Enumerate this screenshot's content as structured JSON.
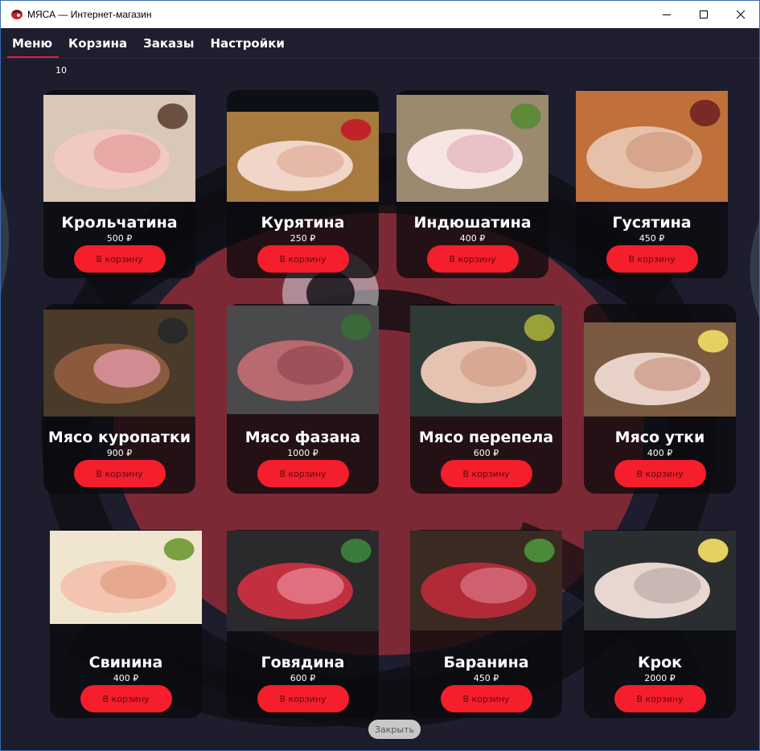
{
  "window": {
    "title": "МЯСА — Интернет-магазин",
    "minimize": "—",
    "maximize": "☐",
    "close": "✕"
  },
  "nav": {
    "tabs": [
      {
        "label": "Меню",
        "active": true
      },
      {
        "label": "Корзина",
        "active": false
      },
      {
        "label": "Заказы",
        "active": false
      },
      {
        "label": "Настройки",
        "active": false
      }
    ]
  },
  "counter": "10",
  "products": [
    {
      "name": "Крольчатина",
      "price": "500 ₽",
      "button": "В корзину",
      "image": "rabbit-meat-image"
    },
    {
      "name": "Курятина",
      "price": "250 ₽",
      "button": "В корзину",
      "image": "chicken-meat-image"
    },
    {
      "name": "Индюшатина",
      "price": "400 ₽",
      "button": "В корзину",
      "image": "turkey-meat-image"
    },
    {
      "name": "Гусятина",
      "price": "450 ₽",
      "button": "В корзину",
      "image": "goose-meat-image"
    },
    {
      "name": "Мясо куропатки",
      "price": "900 ₽",
      "button": "В корзину",
      "image": "partridge-meat-image"
    },
    {
      "name": "Мясо фазана",
      "price": "1000 ₽",
      "button": "В корзину",
      "image": "pheasant-meat-image"
    },
    {
      "name": "Мясо перепела",
      "price": "600 ₽",
      "button": "В корзину",
      "image": "quail-meat-image"
    },
    {
      "name": "Мясо утки",
      "price": "400 ₽",
      "button": "В корзину",
      "image": "duck-meat-image"
    },
    {
      "name": "Свинина",
      "price": "400 ₽",
      "button": "В корзину",
      "image": "pork-meat-image"
    },
    {
      "name": "Говядина",
      "price": "600 ₽",
      "button": "В корзину",
      "image": "beef-meat-image"
    },
    {
      "name": "Баранина",
      "price": "450 ₽",
      "button": "В корзину",
      "image": "lamb-meat-image"
    },
    {
      "name": "Крок",
      "price": "2000 ₽",
      "button": "В корзину",
      "image": "croc-meat-image"
    }
  ],
  "close_button": "Закрыть",
  "colors": {
    "accent": "#f41e2c",
    "background": "#1d1d2d",
    "card": "#0a0a0e"
  }
}
